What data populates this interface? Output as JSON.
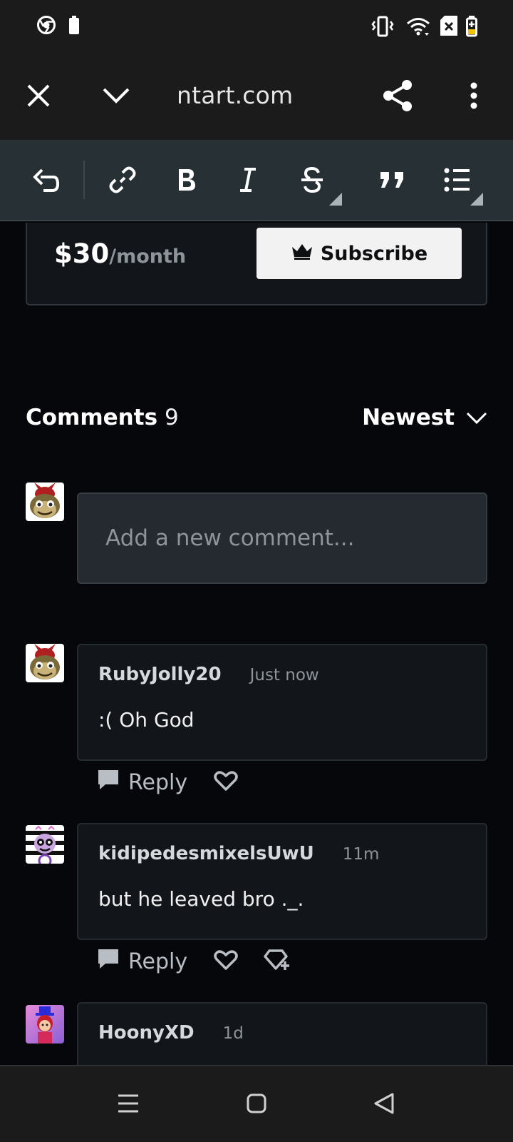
{
  "browser": {
    "url": "ntart.com"
  },
  "subscription": {
    "price": "$30",
    "period": "/month",
    "subscribe_label": "Subscribe"
  },
  "comments": {
    "title": "Comments",
    "count": "9",
    "sort_label": "Newest",
    "new_comment_placeholder": "Add a new comment...",
    "reply_label": "Reply",
    "items": [
      {
        "author": "RubyJolly20",
        "time": "Just now",
        "body": ":( Oh God"
      },
      {
        "author": "kidipedesmixelsUwU",
        "time": "11m",
        "body": "but he leaved bro ._."
      },
      {
        "author": "HoonyXD",
        "time": "1d",
        "body": ""
      }
    ]
  },
  "colors": {
    "background": "#06070b",
    "toolbar": "#263035",
    "card": "#12151a",
    "input": "#242a2f",
    "muted_text": "#8d949a"
  },
  "icons": {
    "status_left": [
      "chrome-icon",
      "battery-saver-icon"
    ],
    "status_right": [
      "vibrate-icon",
      "wifi-icon",
      "sim-off-icon",
      "battery-charging-icon"
    ],
    "toolbar": [
      "undo-icon",
      "link-icon",
      "bold-icon",
      "italic-icon",
      "strikethrough-icon",
      "quote-icon",
      "list-icon"
    ]
  }
}
